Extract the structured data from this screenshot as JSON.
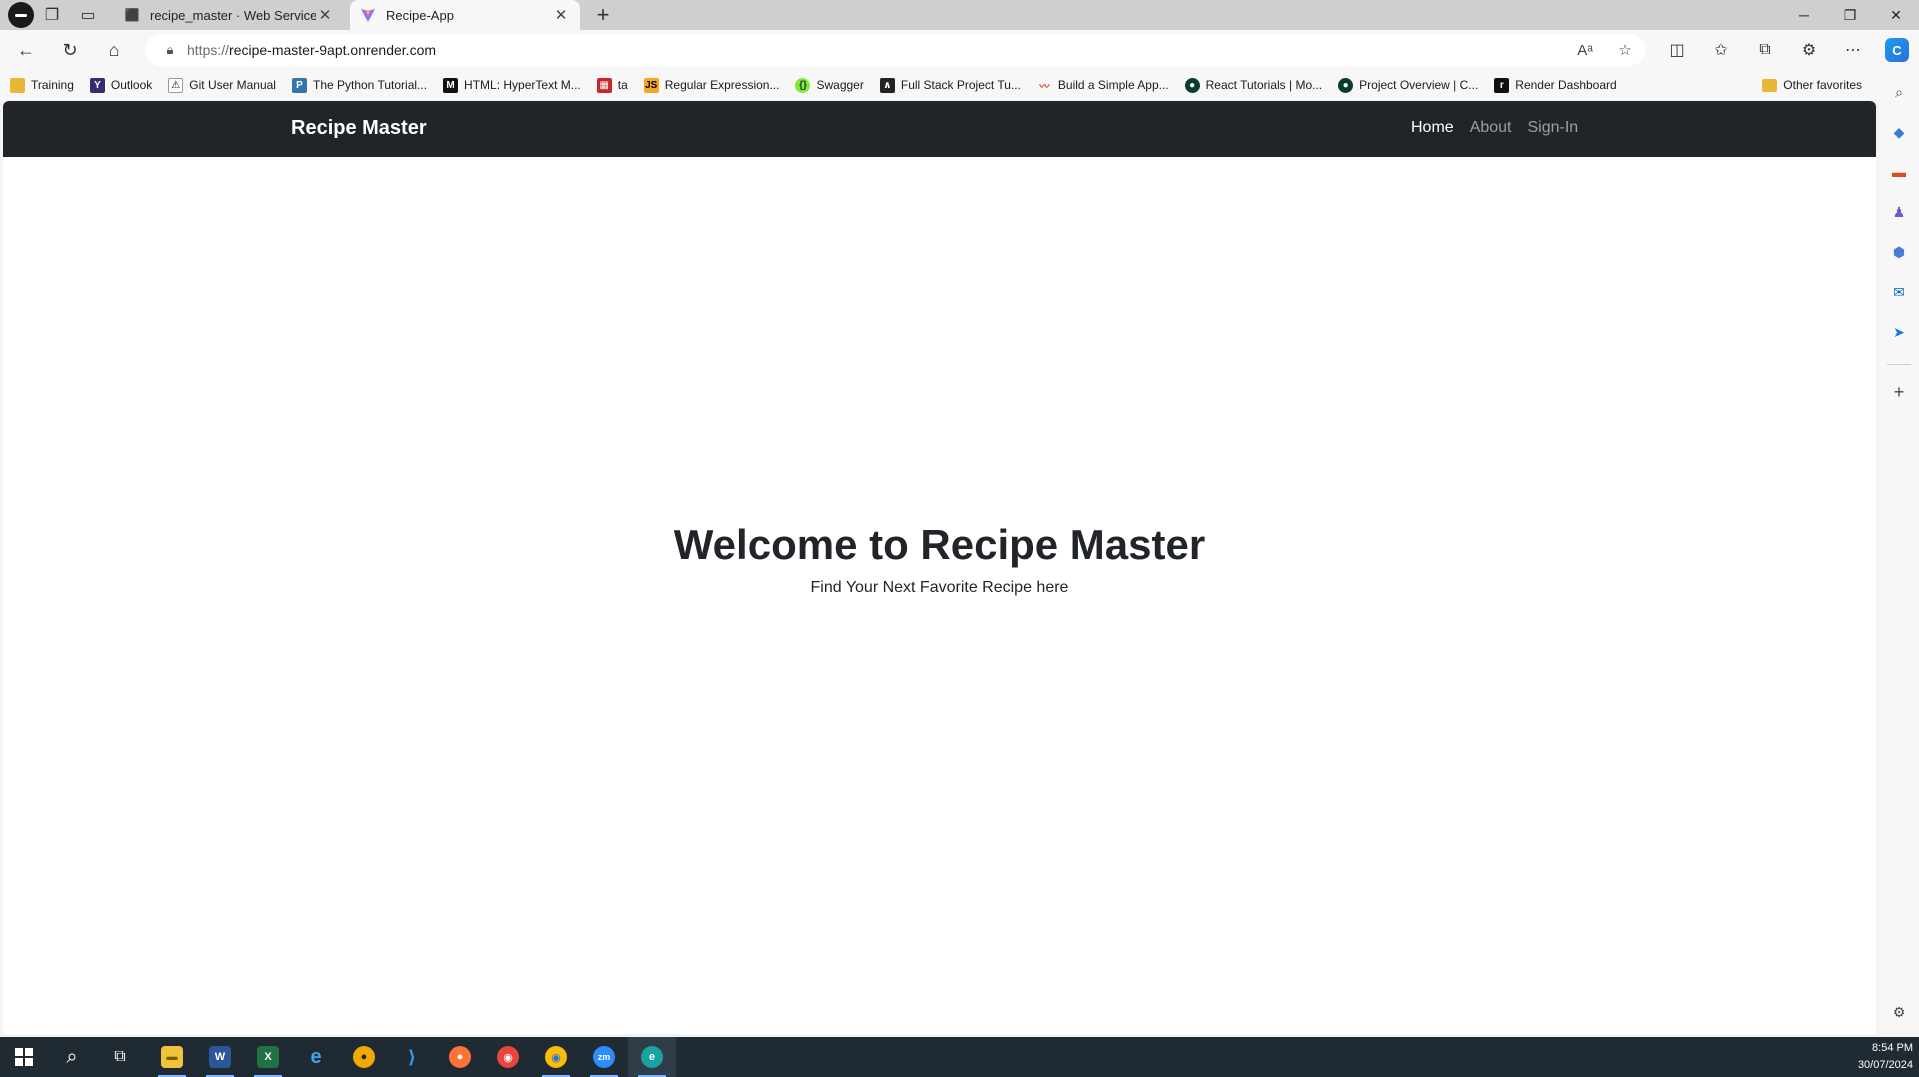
{
  "browser": {
    "tabs": [
      {
        "title": "recipe_master · Web Service · Re",
        "active": false
      },
      {
        "title": "Recipe-App",
        "active": true
      }
    ],
    "url_proto": "https://",
    "url_host": "recipe-master-9apt.onrender.com",
    "favorites": [
      {
        "label": "Training",
        "icon": "folder-icon"
      },
      {
        "label": "Outlook",
        "icon": "outlook-icon"
      },
      {
        "label": "Git User Manual",
        "icon": "git-icon"
      },
      {
        "label": "The Python Tutorial...",
        "icon": "python-icon"
      },
      {
        "label": "HTML: HyperText M...",
        "icon": "mdn-icon"
      },
      {
        "label": "ta",
        "icon": "calendar-icon"
      },
      {
        "label": "Regular Expression...",
        "icon": "regex-icon"
      },
      {
        "label": "Swagger",
        "icon": "swagger-icon"
      },
      {
        "label": "Full Stack Project Tu...",
        "icon": "fullstack-icon"
      },
      {
        "label": "Build a Simple App...",
        "icon": "build-icon"
      },
      {
        "label": "React Tutorials | Mo...",
        "icon": "mongodb-icon"
      },
      {
        "label": "Project Overview | C...",
        "icon": "mongodb-icon"
      },
      {
        "label": "Render Dashboard",
        "icon": "render-icon"
      }
    ],
    "other_favorites": "Other favorites"
  },
  "app": {
    "brand": "Recipe Master",
    "nav": [
      {
        "label": "Home",
        "active": true
      },
      {
        "label": "About",
        "active": false
      },
      {
        "label": "Sign-In",
        "active": false
      }
    ],
    "hero_title": "Welcome to Recipe Master",
    "hero_subtitle": "Find Your Next Favorite Recipe here"
  },
  "taskbar": {
    "time": "8:54 PM",
    "date": "30/07/2024"
  }
}
